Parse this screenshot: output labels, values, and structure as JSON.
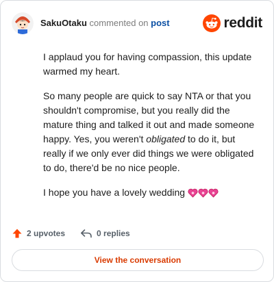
{
  "header": {
    "username": "SakuOtaku",
    "action_text": "commented on",
    "post_link": "post",
    "brand_name": "reddit"
  },
  "comment": {
    "paragraph1": "I applaud you for having compassion, this update warmed my heart.",
    "paragraph2_part1": "So many people are quick to say NTA or that you shouldn't compromise, but you really did the mature thing and talked it out and made someone happy. Yes, you weren't ",
    "paragraph2_emphasis": "obligated",
    "paragraph2_part2": " to do it, but really if we only ever did things we were obligated to do, there'd be no nice people.",
    "paragraph3": "I hope you have a lovely wedding ",
    "emoji": [
      "heart-icon",
      "heart-icon",
      "heart-icon"
    ]
  },
  "footer": {
    "upvotes": "2 upvotes",
    "replies": "0 replies"
  },
  "view_button": "View the conversation",
  "colors": {
    "accent": "#d93a00",
    "upvote": "#ff4500",
    "brand": "#ff4500",
    "link": "#0a4fa3",
    "heart": "#e84393"
  }
}
